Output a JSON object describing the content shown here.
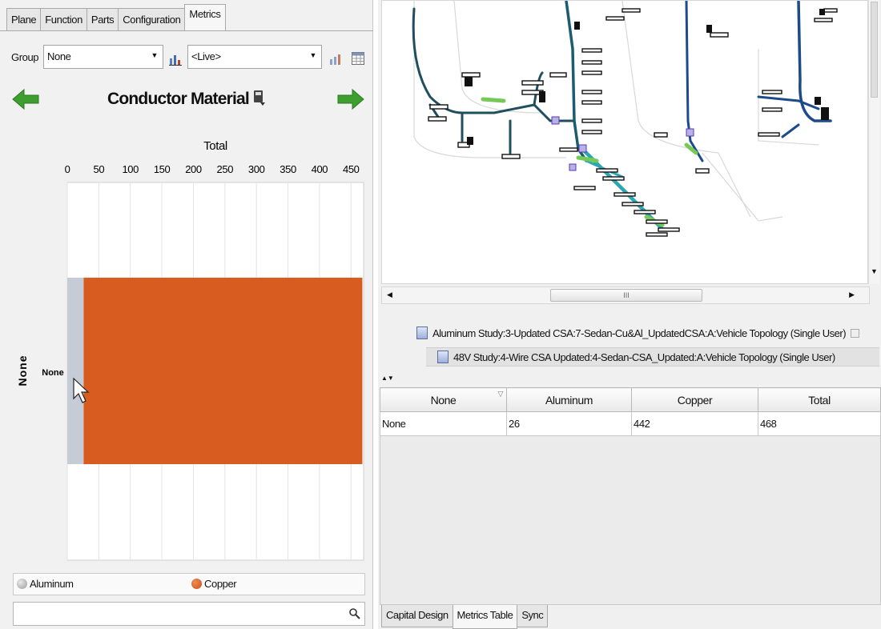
{
  "left_panel": {
    "tabs": [
      "Plane",
      "Function",
      "Parts",
      "Configuration",
      "Metrics"
    ],
    "active_tab": "Metrics",
    "group_label": "Group",
    "group_select": "None",
    "view_select": "<Live>",
    "title": "Conductor Material",
    "legend": [
      {
        "label": "Aluminum",
        "color": "#b4b4b4"
      },
      {
        "label": "Copper",
        "color": "#d85c1f"
      }
    ],
    "search_icon": "magnifier-icon"
  },
  "chart_data": {
    "type": "bar",
    "orientation": "horizontal",
    "stacked": true,
    "title": "Total",
    "xlabel": "Total",
    "ylabel": "None",
    "categories": [
      "None"
    ],
    "xlim": [
      0,
      470
    ],
    "xticks": [
      0,
      50,
      100,
      150,
      200,
      250,
      300,
      350,
      400,
      450
    ],
    "series": [
      {
        "name": "Aluminum",
        "values": [
          26
        ],
        "color": "#c5ccd6"
      },
      {
        "name": "Copper",
        "values": [
          442
        ],
        "color": "#d85c1f"
      }
    ],
    "grid": true
  },
  "right_panel": {
    "documents": [
      "Aluminum Study:3-Updated CSA:7-Sedan-Cu&Al_UpdatedCSA:A:Vehicle Topology (Single User)",
      "48V Study:4-Wire CSA Updated:4-Sedan-CSA_Updated:A:Vehicle Topology (Single User)"
    ],
    "table": {
      "headers": [
        "None",
        "Aluminum",
        "Copper",
        "Total"
      ],
      "rows": [
        [
          "None",
          "26",
          "442",
          "468"
        ]
      ]
    },
    "bottom_tabs": [
      "Capital Design",
      "Metrics Table",
      "Sync"
    ],
    "active_bottom_tab": "Metrics Table",
    "scroll_thumb_glyph": "III"
  }
}
